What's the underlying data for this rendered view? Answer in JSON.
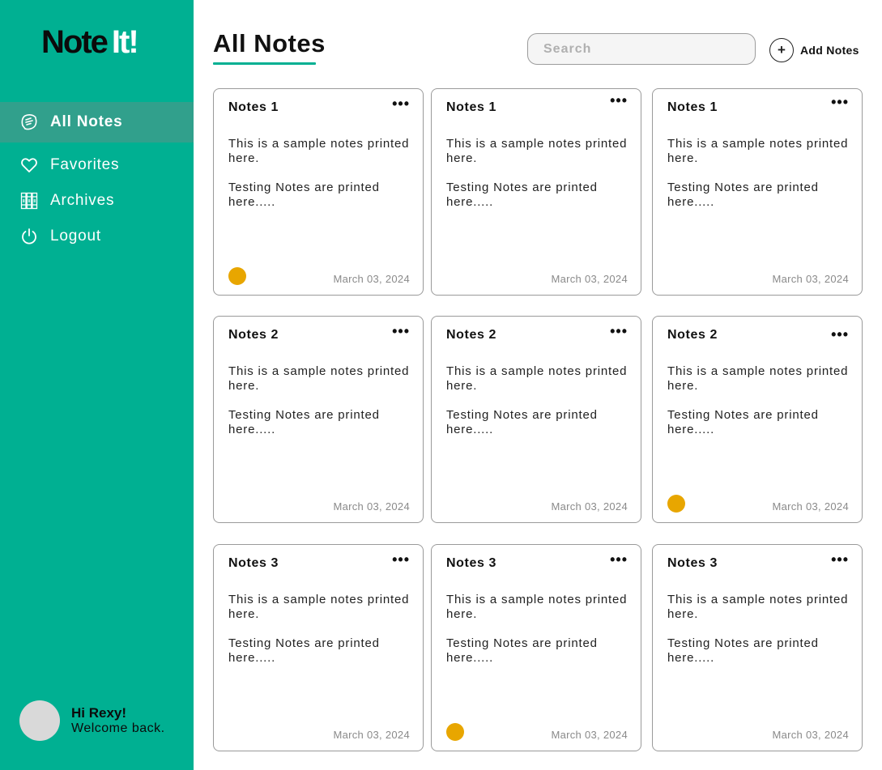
{
  "sidebar": {
    "logo_part1": "Note",
    "logo_part2": "It!",
    "items": [
      {
        "label": "All Notes",
        "icon": "notes-icon",
        "active": true
      },
      {
        "label": "Favorites",
        "icon": "heart-icon"
      },
      {
        "label": "Archives",
        "icon": "archive-icon"
      },
      {
        "label": "Logout",
        "icon": "power-icon"
      }
    ],
    "user": {
      "greeting": "Hi Rexy!",
      "subtitle": "Welcome back."
    }
  },
  "header": {
    "title": "All Notes",
    "search_placeholder": "Search",
    "add_label": "Add Notes",
    "add_symbol": "+"
  },
  "colors": {
    "accent": "#00b092",
    "active_nav": "#31a08c",
    "favorite_dot": "#e8a600"
  },
  "notes": [
    {
      "title": "Notes 1",
      "line1": "This is a sample notes printed here.",
      "line2": "Testing Notes are printed here.....",
      "date": "March 03, 2024",
      "favorite": true
    },
    {
      "title": "Notes 1",
      "line1": "This is a sample notes printed here.",
      "line2": "Testing Notes are printed here.....",
      "date": "March 03, 2024",
      "favorite": false
    },
    {
      "title": "Notes 1",
      "line1": "This is a sample notes printed here.",
      "line2": "Testing Notes are printed here.....",
      "date": "March 03, 2024",
      "favorite": false
    },
    {
      "title": "Notes 2",
      "line1": "This is a sample notes printed here.",
      "line2": "Testing Notes are printed here.....",
      "date": "March 03, 2024",
      "favorite": false
    },
    {
      "title": "Notes 2",
      "line1": "This is a sample notes printed here.",
      "line2": "Testing Notes are printed here.....",
      "date": "March 03, 2024",
      "favorite": false
    },
    {
      "title": "Notes 2",
      "line1": "This is a sample notes printed here.",
      "line2": "Testing Notes are printed here.....",
      "date": "March 03, 2024",
      "favorite": true
    },
    {
      "title": "Notes 3",
      "line1": "This is a sample notes printed here.",
      "line2": "Testing Notes are printed here.....",
      "date": "March 03, 2024",
      "favorite": false
    },
    {
      "title": "Notes 3",
      "line1": "This is a sample notes printed here.",
      "line2": "Testing Notes are printed here.....",
      "date": "March 03, 2024",
      "favorite": true
    },
    {
      "title": "Notes 3",
      "line1": "This is a sample notes printed here.",
      "line2": "Testing Notes are printed here.....",
      "date": "March 03, 2024",
      "favorite": false
    }
  ],
  "menu_glyph": "•••"
}
